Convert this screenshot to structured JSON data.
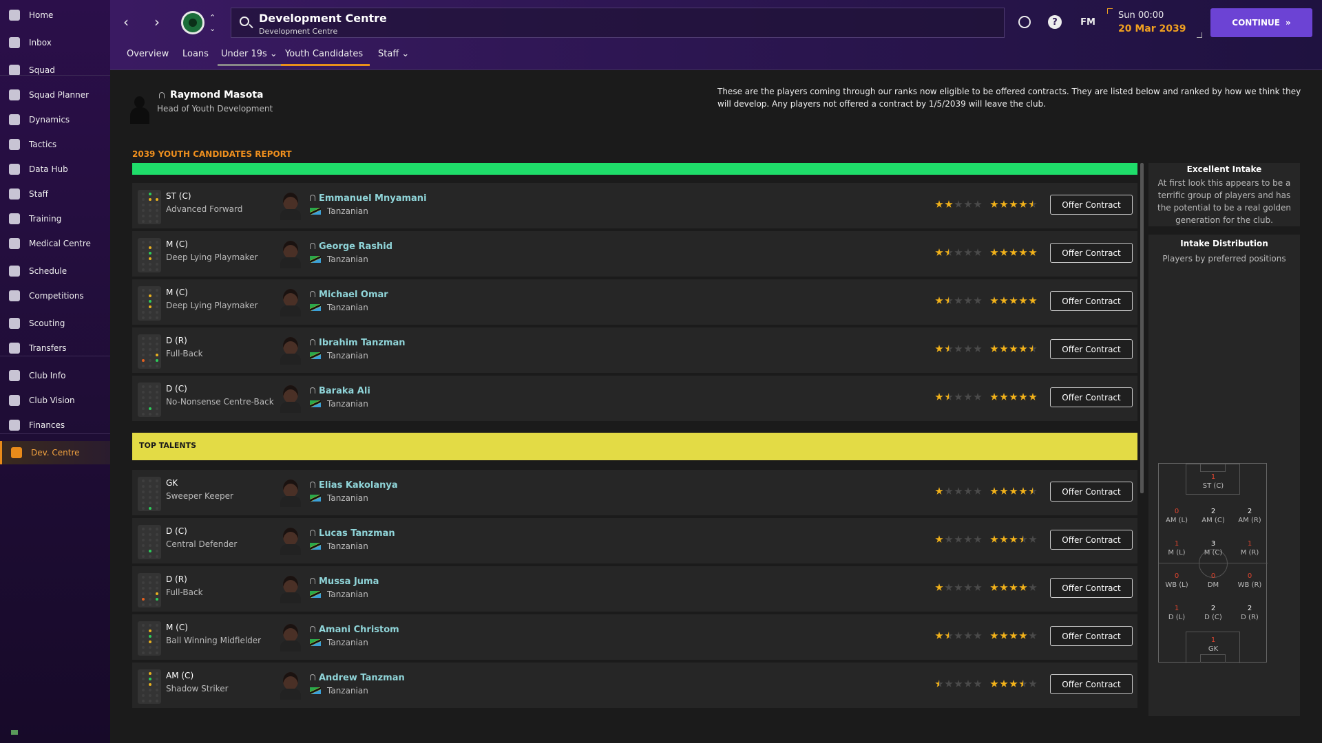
{
  "sidebar": {
    "items": [
      {
        "label": "Home",
        "icon": "home-icon"
      },
      {
        "label": "Inbox",
        "icon": "inbox-icon"
      },
      {
        "label": "Squad",
        "icon": "shirt-icon"
      },
      {
        "label": "Squad Planner",
        "icon": "planner-icon"
      },
      {
        "label": "Dynamics",
        "icon": "dynamics-icon"
      },
      {
        "label": "Tactics",
        "icon": "tactics-icon"
      },
      {
        "label": "Data Hub",
        "icon": "data-hub-icon"
      },
      {
        "label": "Staff",
        "icon": "staff-icon"
      },
      {
        "label": "Training",
        "icon": "training-icon"
      },
      {
        "label": "Medical Centre",
        "icon": "medical-icon"
      },
      {
        "label": "Schedule",
        "icon": "calendar-icon"
      },
      {
        "label": "Competitions",
        "icon": "trophy-icon"
      },
      {
        "label": "Scouting",
        "icon": "scouting-icon"
      },
      {
        "label": "Transfers",
        "icon": "transfers-icon"
      },
      {
        "label": "Club Info",
        "icon": "club-info-icon"
      },
      {
        "label": "Club Vision",
        "icon": "club-vision-icon"
      },
      {
        "label": "Finances",
        "icon": "finances-icon"
      },
      {
        "label": "Dev. Centre",
        "icon": "dev-centre-icon",
        "active": true
      }
    ]
  },
  "header": {
    "title": "Development Centre",
    "subtitle": "Development Centre",
    "fm_label": "FM",
    "date_time": "Sun 00:00",
    "date": "20 Mar 2039",
    "continue_label": "CONTINUE"
  },
  "tabs": [
    {
      "label": "Overview"
    },
    {
      "label": "Loans"
    },
    {
      "label": "Under 19s ⌄"
    },
    {
      "label": "Youth Candidates"
    },
    {
      "label": "Staff ⌄"
    }
  ],
  "staff": {
    "name": "Raymond Masota",
    "role": "Head of Youth Development"
  },
  "intro_text": "These are the players coming through our ranks now eligible to be offered contracts. They are listed below and ranked by how we think they will develop. Any players not offered a contract by 1/5/2039 will leave the club.",
  "report_title": "2039 YOUTH CANDIDATES REPORT",
  "top_talents_label": "TOP TALENTS",
  "offer_label": "Offer Contract",
  "colors": {
    "accent": "#e8901a",
    "continue": "#6c43d4",
    "excellent_band": "#1fdd6a",
    "top_talents_band": "#e3db45"
  },
  "candidates": [
    {
      "pos": "ST (C)",
      "role": "Advanced Forward",
      "name": "Emmanuel Mnyamani",
      "nat": "Tanzanian",
      "ca": 2,
      "pa": 4.5
    },
    {
      "pos": "M (C)",
      "role": "Deep Lying Playmaker",
      "name": "George Rashid",
      "nat": "Tanzanian",
      "ca": 1.5,
      "pa": 5
    },
    {
      "pos": "M (C)",
      "role": "Deep Lying Playmaker",
      "name": "Michael Omar",
      "nat": "Tanzanian",
      "ca": 1.5,
      "pa": 5
    },
    {
      "pos": "D (R)",
      "role": "Full-Back",
      "name": "Ibrahim Tanzman",
      "nat": "Tanzanian",
      "ca": 1.5,
      "pa": 4.5
    },
    {
      "pos": "D (C)",
      "role": "No-Nonsense Centre-Back",
      "name": "Baraka Ali",
      "nat": "Tanzanian",
      "ca": 1.5,
      "pa": 5
    },
    {
      "pos": "GK",
      "role": "Sweeper Keeper",
      "name": "Elias Kakolanya",
      "nat": "Tanzanian",
      "ca": 1,
      "pa": 4.5
    },
    {
      "pos": "D (C)",
      "role": "Central Defender",
      "name": "Lucas Tanzman",
      "nat": "Tanzanian",
      "ca": 1,
      "pa": 3.5
    },
    {
      "pos": "D (R)",
      "role": "Full-Back",
      "name": "Mussa Juma",
      "nat": "Tanzanian",
      "ca": 1,
      "pa": 4
    },
    {
      "pos": "M (C)",
      "role": "Ball Winning Midfielder",
      "name": "Amani Christom",
      "nat": "Tanzanian",
      "ca": 1.5,
      "pa": 4
    },
    {
      "pos": "AM (C)",
      "role": "Shadow Striker",
      "name": "Andrew Tanzman",
      "nat": "Tanzanian",
      "ca": 0.5,
      "pa": 3.5
    }
  ],
  "intake": {
    "title": "Excellent Intake",
    "text": "At first look this appears to be a terrific group of players and has the potential to be a real golden generation for the club.",
    "dist_title": "Intake Distribution",
    "dist_sub": "Players by preferred positions",
    "zones": [
      {
        "label": "ST (C)",
        "count": "1"
      },
      {
        "label": "AM (L)",
        "count": "0"
      },
      {
        "label": "AM (C)",
        "count": "2"
      },
      {
        "label": "AM (R)",
        "count": "2"
      },
      {
        "label": "M (L)",
        "count": "1"
      },
      {
        "label": "M (C)",
        "count": "3"
      },
      {
        "label": "M (R)",
        "count": "1"
      },
      {
        "label": "WB (L)",
        "count": "0"
      },
      {
        "label": "DM",
        "count": "0"
      },
      {
        "label": "WB (R)",
        "count": "0"
      },
      {
        "label": "D (L)",
        "count": "1"
      },
      {
        "label": "D (C)",
        "count": "2"
      },
      {
        "label": "D (R)",
        "count": "2"
      },
      {
        "label": "GK",
        "count": "1"
      }
    ]
  }
}
